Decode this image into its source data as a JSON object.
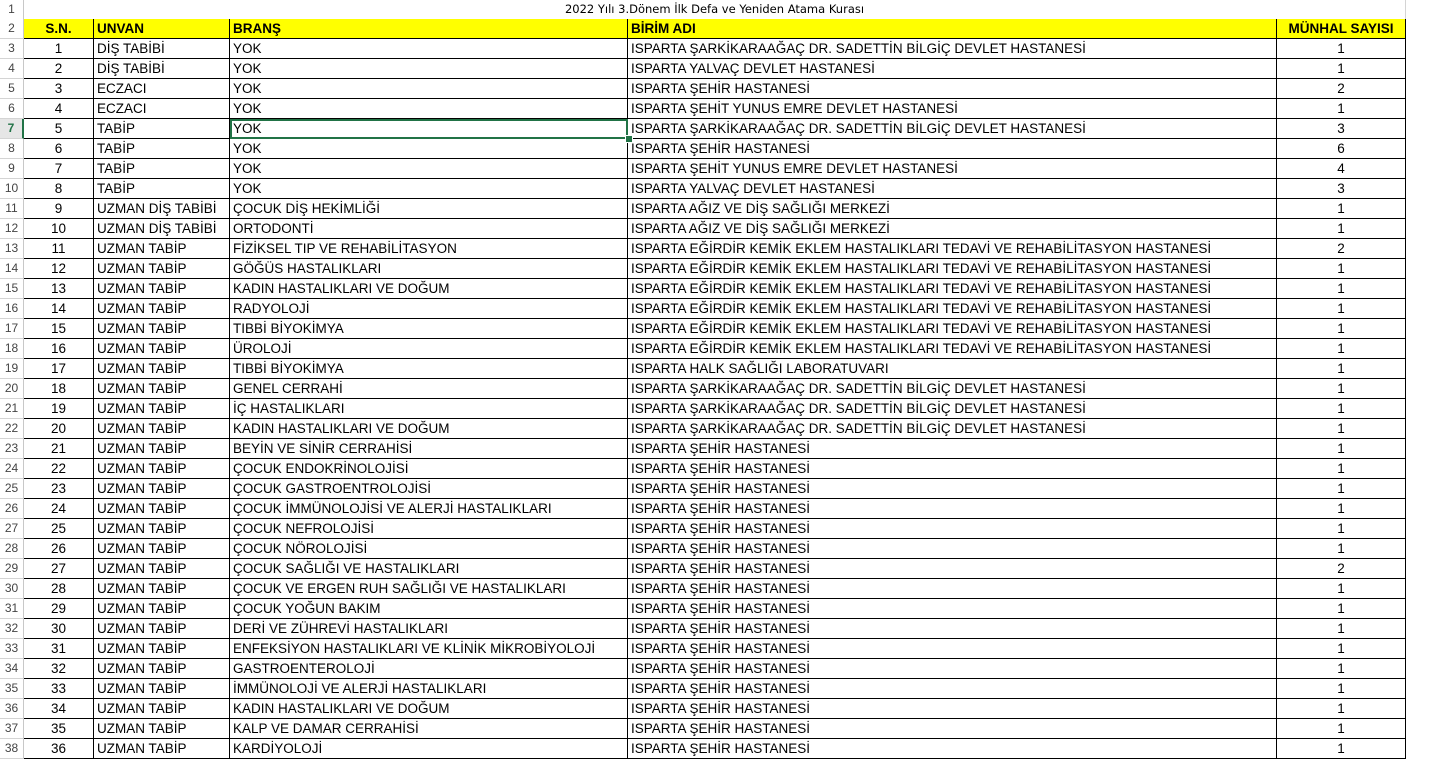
{
  "sheet": {
    "title": "2022 Yılı 3.Dönem İlk Defa ve Yeniden Atama Kurası",
    "headers": [
      "S.N.",
      "UNVAN",
      "BRANŞ",
      "BİRİM ADI",
      "MÜNHAL SAYISI"
    ],
    "row_numbers": [
      "1",
      "2",
      "3",
      "4",
      "5",
      "6",
      "7",
      "8",
      "9",
      "10",
      "11",
      "12",
      "13",
      "14",
      "15",
      "16",
      "17",
      "18",
      "19",
      "20",
      "21",
      "22",
      "23",
      "24",
      "25",
      "26",
      "27",
      "28",
      "29",
      "30",
      "31",
      "32",
      "33",
      "34",
      "35",
      "36",
      "37",
      "38"
    ],
    "active_row": "7",
    "selected_cell": "C7",
    "rows": [
      [
        "1",
        "DİŞ TABİBİ",
        "YOK",
        "ISPARTA ŞARKİKARAAĞAÇ DR. SADETTİN BİLGİÇ DEVLET HASTANESİ",
        "1"
      ],
      [
        "2",
        "DİŞ TABİBİ",
        "YOK",
        "ISPARTA YALVAÇ DEVLET HASTANESİ",
        "1"
      ],
      [
        "3",
        "ECZACI",
        "YOK",
        "ISPARTA ŞEHİR HASTANESİ",
        "2"
      ],
      [
        "4",
        "ECZACI",
        "YOK",
        "ISPARTA ŞEHİT YUNUS EMRE DEVLET HASTANESİ",
        "1"
      ],
      [
        "5",
        "TABİP",
        "YOK",
        "ISPARTA ŞARKİKARAAĞAÇ DR. SADETTİN BİLGİÇ DEVLET HASTANESİ",
        "3"
      ],
      [
        "6",
        "TABİP",
        "YOK",
        "ISPARTA ŞEHİR HASTANESİ",
        "6"
      ],
      [
        "7",
        "TABİP",
        "YOK",
        "ISPARTA ŞEHİT YUNUS EMRE DEVLET HASTANESİ",
        "4"
      ],
      [
        "8",
        "TABİP",
        "YOK",
        "ISPARTA YALVAÇ DEVLET HASTANESİ",
        "3"
      ],
      [
        "9",
        "UZMAN DİŞ TABİBİ",
        "ÇOCUK DİŞ HEKİMLİĞİ",
        "ISPARTA AĞIZ VE DİŞ SAĞLIĞI MERKEZİ",
        "1"
      ],
      [
        "10",
        "UZMAN DİŞ TABİBİ",
        "ORTODONTİ",
        "ISPARTA AĞIZ VE DİŞ SAĞLIĞI MERKEZİ",
        "1"
      ],
      [
        "11",
        "UZMAN TABİP",
        "FİZİKSEL TIP VE REHABİLİTASYON",
        "ISPARTA EĞİRDİR KEMİK EKLEM HASTALIKLARI TEDAVİ VE REHABİLİTASYON HASTANESİ",
        "2"
      ],
      [
        "12",
        "UZMAN TABİP",
        "GÖĞÜS HASTALIKLARI",
        "ISPARTA EĞİRDİR KEMİK EKLEM HASTALIKLARI TEDAVİ VE REHABİLİTASYON HASTANESİ",
        "1"
      ],
      [
        "13",
        "UZMAN TABİP",
        "KADIN HASTALIKLARI VE DOĞUM",
        "ISPARTA EĞİRDİR KEMİK EKLEM HASTALIKLARI TEDAVİ VE REHABİLİTASYON HASTANESİ",
        "1"
      ],
      [
        "14",
        "UZMAN TABİP",
        "RADYOLOJİ",
        "ISPARTA EĞİRDİR KEMİK EKLEM HASTALIKLARI TEDAVİ VE REHABİLİTASYON HASTANESİ",
        "1"
      ],
      [
        "15",
        "UZMAN TABİP",
        "TIBBİ BİYOKİMYA",
        "ISPARTA EĞİRDİR KEMİK EKLEM HASTALIKLARI TEDAVİ VE REHABİLİTASYON HASTANESİ",
        "1"
      ],
      [
        "16",
        "UZMAN TABİP",
        "ÜROLOJİ",
        "ISPARTA EĞİRDİR KEMİK EKLEM HASTALIKLARI TEDAVİ VE REHABİLİTASYON HASTANESİ",
        "1"
      ],
      [
        "17",
        "UZMAN TABİP",
        "TIBBİ BİYOKİMYA",
        "ISPARTA HALK SAĞLIĞI LABORATUVARI",
        "1"
      ],
      [
        "18",
        "UZMAN TABİP",
        "GENEL CERRAHİ",
        "ISPARTA ŞARKİKARAAĞAÇ DR. SADETTİN BİLGİÇ DEVLET HASTANESİ",
        "1"
      ],
      [
        "19",
        "UZMAN TABİP",
        "İÇ HASTALIKLARI",
        "ISPARTA ŞARKİKARAAĞAÇ DR. SADETTİN BİLGİÇ DEVLET HASTANESİ",
        "1"
      ],
      [
        "20",
        "UZMAN TABİP",
        "KADIN HASTALIKLARI VE DOĞUM",
        "ISPARTA ŞARKİKARAAĞAÇ DR. SADETTİN BİLGİÇ DEVLET HASTANESİ",
        "1"
      ],
      [
        "21",
        "UZMAN TABİP",
        "BEYİN VE SİNİR CERRAHİSİ",
        "ISPARTA ŞEHİR HASTANESİ",
        "1"
      ],
      [
        "22",
        "UZMAN TABİP",
        "ÇOCUK ENDOKRİNOLOJİSİ",
        "ISPARTA ŞEHİR HASTANESİ",
        "1"
      ],
      [
        "23",
        "UZMAN TABİP",
        "ÇOCUK GASTROENTROLOJİSİ",
        "ISPARTA ŞEHİR HASTANESİ",
        "1"
      ],
      [
        "24",
        "UZMAN TABİP",
        "ÇOCUK İMMÜNOLOJİSİ VE ALERJİ HASTALIKLARI",
        "ISPARTA ŞEHİR HASTANESİ",
        "1"
      ],
      [
        "25",
        "UZMAN TABİP",
        "ÇOCUK NEFROLOJİSİ",
        "ISPARTA ŞEHİR HASTANESİ",
        "1"
      ],
      [
        "26",
        "UZMAN TABİP",
        "ÇOCUK NÖROLOJİSİ",
        "ISPARTA ŞEHİR HASTANESİ",
        "1"
      ],
      [
        "27",
        "UZMAN TABİP",
        "ÇOCUK SAĞLIĞI VE HASTALIKLARI",
        "ISPARTA ŞEHİR HASTANESİ",
        "2"
      ],
      [
        "28",
        "UZMAN TABİP",
        "ÇOCUK VE ERGEN RUH SAĞLIĞI VE HASTALIKLARI",
        "ISPARTA ŞEHİR HASTANESİ",
        "1"
      ],
      [
        "29",
        "UZMAN TABİP",
        "ÇOCUK YOĞUN BAKIM",
        "ISPARTA ŞEHİR HASTANESİ",
        "1"
      ],
      [
        "30",
        "UZMAN TABİP",
        "DERİ VE ZÜHREVİ HASTALIKLARI",
        "ISPARTA ŞEHİR HASTANESİ",
        "1"
      ],
      [
        "31",
        "UZMAN TABİP",
        "ENFEKSİYON HASTALIKLARI VE KLİNİK MİKROBİYOLOJİ",
        "ISPARTA ŞEHİR HASTANESİ",
        "1"
      ],
      [
        "32",
        "UZMAN TABİP",
        "GASTROENTEROLOJİ",
        "ISPARTA ŞEHİR HASTANESİ",
        "1"
      ],
      [
        "33",
        "UZMAN TABİP",
        "İMMÜNOLOJİ VE ALERJİ HASTALIKLARI",
        "ISPARTA ŞEHİR HASTANESİ",
        "1"
      ],
      [
        "34",
        "UZMAN TABİP",
        "KADIN HASTALIKLARI VE DOĞUM",
        "ISPARTA ŞEHİR HASTANESİ",
        "1"
      ],
      [
        "35",
        "UZMAN TABİP",
        "KALP VE DAMAR CERRAHİSİ",
        "ISPARTA ŞEHİR HASTANESİ",
        "1"
      ],
      [
        "36",
        "UZMAN TABİP",
        "KARDİYOLOJİ",
        "ISPARTA ŞEHİR HASTANESİ",
        "1"
      ]
    ],
    "colors": {
      "header_fill": "#ffff00",
      "selection": "#217346"
    }
  }
}
